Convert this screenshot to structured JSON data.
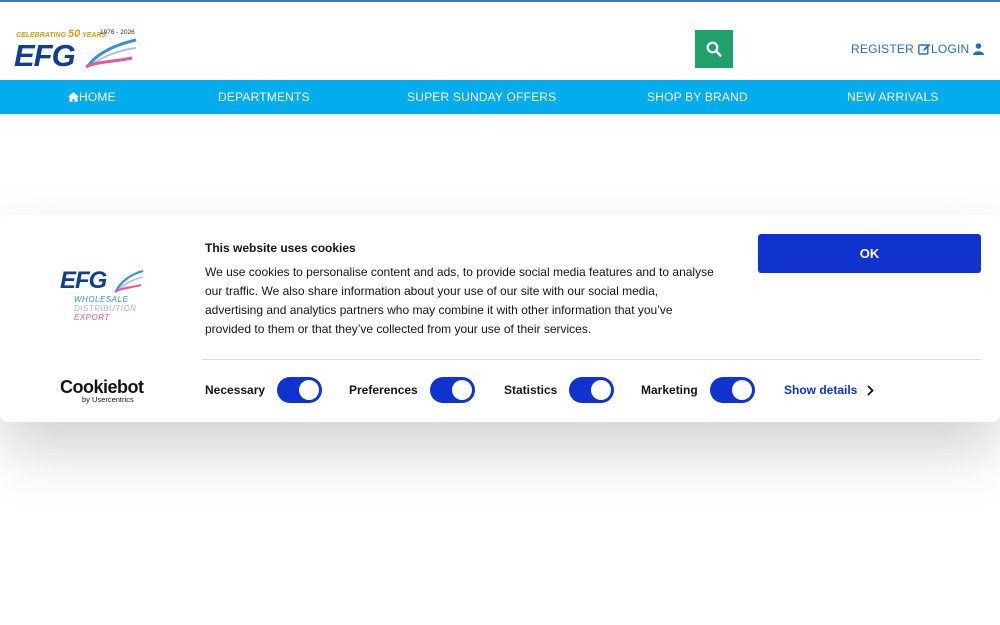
{
  "header": {
    "logo": {
      "celebrating_text": "CELEBRATING",
      "years_number": "50",
      "years_word": "YEARS",
      "year_range": "1976 - 2026",
      "brand": "EFG"
    },
    "search_icon": "search-icon",
    "register_label": "REGISTER",
    "login_label": "LOGIN"
  },
  "nav": {
    "items": [
      {
        "label": "HOME",
        "icon": "home-icon"
      },
      {
        "label": "DEPARTMENTS"
      },
      {
        "label": "SUPER SUNDAY OFFERS"
      },
      {
        "label": "SHOP BY BRAND"
      },
      {
        "label": "NEW ARRIVALS"
      }
    ]
  },
  "cookie_banner": {
    "logo": {
      "brand": "EFG",
      "line1": "WHOLESALE",
      "line2": "DISTRIBUTION",
      "line3": "EXPORT"
    },
    "cookiebot": {
      "name": "Cookiebot",
      "by": "by Usercentrics"
    },
    "title": "This website uses cookies",
    "text": "We use cookies to personalise content and ads, to provide social media features and to analyse our traffic. We also share information about your use of our site with our social media, advertising and analytics partners who may combine it with other information that you’ve provided to them or that they’ve collected from your use of their services.",
    "ok_label": "OK",
    "toggles": [
      {
        "label": "Necessary",
        "on": true
      },
      {
        "label": "Preferences",
        "on": true
      },
      {
        "label": "Statistics",
        "on": true
      },
      {
        "label": "Marketing",
        "on": true
      }
    ],
    "show_details_label": "Show details"
  },
  "colors": {
    "nav_bg": "#03aced",
    "search_bg": "#22a06b",
    "brand_blue": "#123f8c",
    "link_blue": "#2a6db5",
    "cookie_accent": "#1032cf"
  }
}
